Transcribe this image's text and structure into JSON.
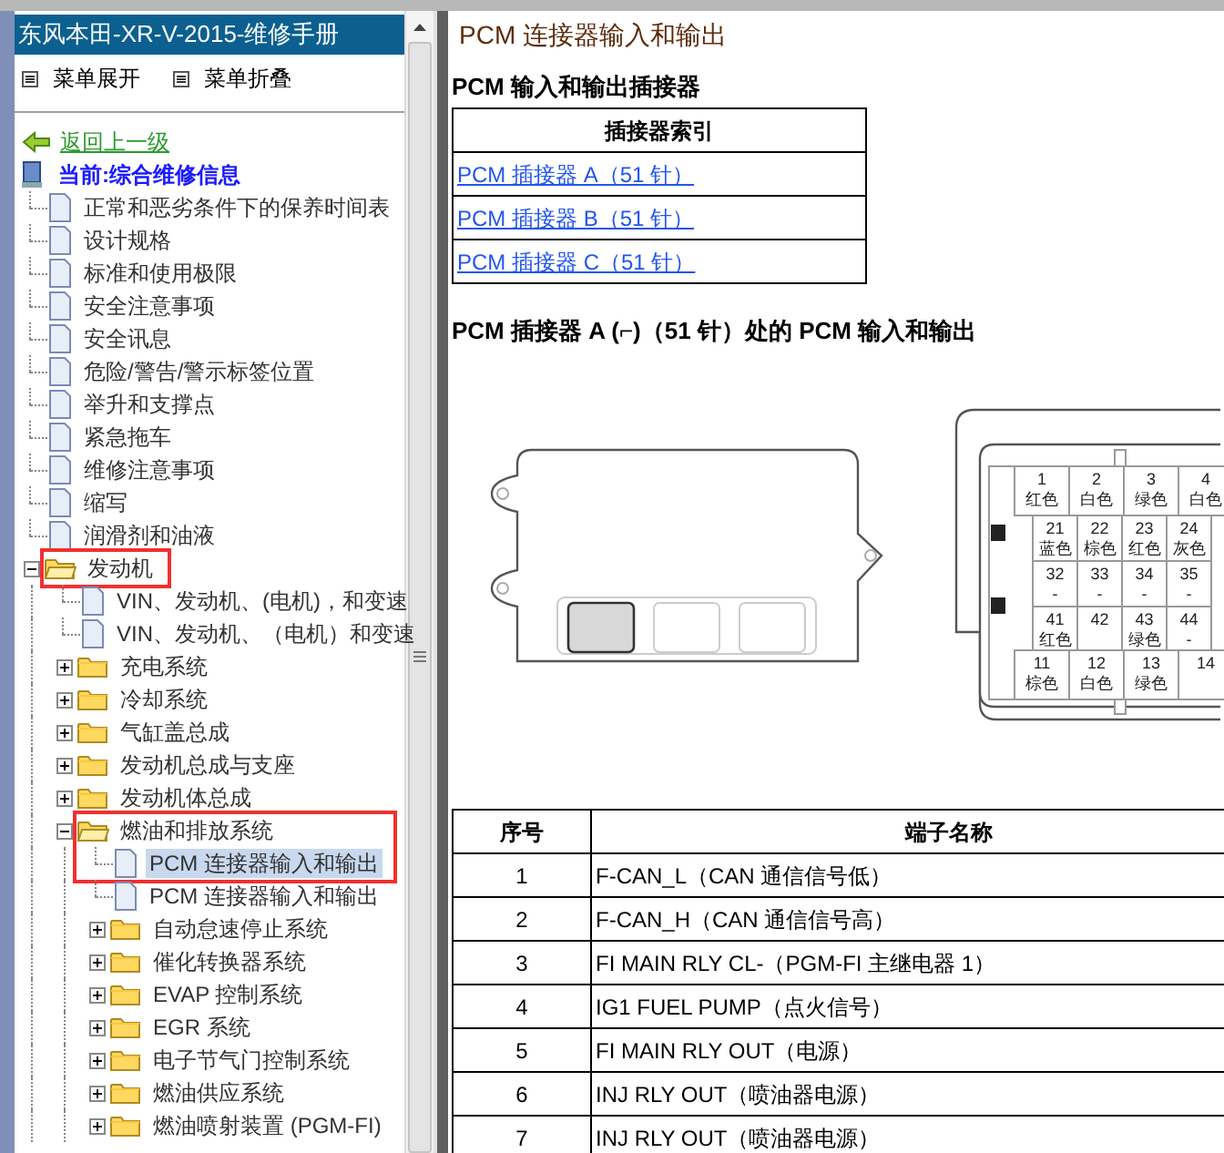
{
  "sidebar": {
    "title": "东风本田-XR-V-2015-维修手册",
    "menu_buttons": [
      "菜单展开",
      "菜单折叠"
    ],
    "back_link": "返回上一级",
    "current": "当前:综合维修信息",
    "tree": [
      {
        "label": "正常和恶劣条件下的保养时间表",
        "kind": "page",
        "selected": false
      },
      {
        "label": "设计规格",
        "kind": "page",
        "selected": false
      },
      {
        "label": "标准和使用极限",
        "kind": "page",
        "selected": false
      },
      {
        "label": "安全注意事项",
        "kind": "page",
        "selected": false
      },
      {
        "label": "安全讯息",
        "kind": "page",
        "selected": false
      },
      {
        "label": "危险/警告/警示标签位置",
        "kind": "page",
        "selected": false
      },
      {
        "label": "举升和支撑点",
        "kind": "page",
        "selected": false
      },
      {
        "label": "紧急拖车",
        "kind": "page",
        "selected": false
      },
      {
        "label": "维修注意事项",
        "kind": "page",
        "selected": false
      },
      {
        "label": "缩写",
        "kind": "page",
        "selected": false
      },
      {
        "label": "润滑剂和油液",
        "kind": "page",
        "selected": false
      },
      {
        "label": "发动机",
        "kind": "folder",
        "expanded": true,
        "selected": false,
        "highlighted": true,
        "children": [
          {
            "label": "VIN、发动机、(电机)，和变速",
            "kind": "page",
            "selected": false
          },
          {
            "label": "VIN、发动机、（电机）和变速",
            "kind": "page",
            "selected": false
          },
          {
            "label": "充电系统",
            "kind": "folder",
            "expanded": false,
            "selected": false
          },
          {
            "label": "冷却系统",
            "kind": "folder",
            "expanded": false,
            "selected": false
          },
          {
            "label": "气缸盖总成",
            "kind": "folder",
            "expanded": false,
            "selected": false
          },
          {
            "label": "发动机总成与支座",
            "kind": "folder",
            "expanded": false,
            "selected": false
          },
          {
            "label": "发动机体总成",
            "kind": "folder",
            "expanded": false,
            "selected": false
          },
          {
            "label": "燃油和排放系统",
            "kind": "folder",
            "expanded": true,
            "selected": false,
            "highlighted": true,
            "children": [
              {
                "label": "PCM 连接器输入和输出",
                "kind": "page",
                "selected": true,
                "highlighted": true
              },
              {
                "label": "PCM 连接器输入和输出",
                "kind": "page",
                "selected": false
              },
              {
                "label": "自动怠速停止系统",
                "kind": "folder",
                "expanded": false,
                "selected": false
              },
              {
                "label": "催化转换器系统",
                "kind": "folder",
                "expanded": false,
                "selected": false
              },
              {
                "label": "EVAP 控制系统",
                "kind": "folder",
                "expanded": false,
                "selected": false
              },
              {
                "label": "EGR 系统",
                "kind": "folder",
                "expanded": false,
                "selected": false
              },
              {
                "label": "电子节气门控制系统",
                "kind": "folder",
                "expanded": false,
                "selected": false
              },
              {
                "label": "燃油供应系统",
                "kind": "folder",
                "expanded": false,
                "selected": false
              },
              {
                "label": "燃油喷射装置 (PGM-FI)",
                "kind": "folder",
                "expanded": false,
                "selected": false
              }
            ]
          }
        ]
      }
    ]
  },
  "content": {
    "title": "PCM 连接器输入和输出",
    "index_heading": "PCM 输入和输出插接器",
    "index_table": {
      "header": "插接器索引",
      "links": [
        "PCM 插接器 A（51 针）",
        "PCM 插接器 B（51 针）",
        "PCM 插接器 C（51 针）"
      ]
    },
    "connector_heading": "PCM 插接器 A (⌐)（51 针）处的 PCM 输入和输出",
    "connector": {
      "rows": [
        {
          "kind": "wide",
          "pins": [
            {
              "number": "1",
              "wire_color": "红色"
            },
            {
              "number": "2",
              "wire_color": "白色"
            },
            {
              "number": "3",
              "wire_color": "绿色"
            },
            {
              "number": "4",
              "wire_color": "白色"
            }
          ]
        },
        {
          "kind": "narrow",
          "pins": [
            {
              "number": "21",
              "wire_color": "蓝色"
            },
            {
              "number": "22",
              "wire_color": "棕色"
            },
            {
              "number": "23",
              "wire_color": "红色"
            },
            {
              "number": "24",
              "wire_color": "灰色"
            }
          ]
        },
        {
          "kind": "narrow",
          "pins": [
            {
              "number": "32",
              "wire_color": "-"
            },
            {
              "number": "33",
              "wire_color": "-"
            },
            {
              "number": "34",
              "wire_color": "-"
            },
            {
              "number": "35",
              "wire_color": "-"
            }
          ]
        },
        {
          "kind": "narrow",
          "pins": [
            {
              "number": "41",
              "wire_color": "红色"
            },
            {
              "number": "42"
            },
            {
              "number": "43",
              "wire_color": "绿色"
            },
            {
              "number": "44",
              "wire_color": "-"
            }
          ]
        },
        {
          "kind": "wide",
          "pins": [
            {
              "number": "11",
              "wire_color": "棕色"
            },
            {
              "number": "12",
              "wire_color": "白色"
            },
            {
              "number": "13",
              "wire_color": "绿色"
            },
            {
              "number": "14"
            }
          ]
        }
      ]
    },
    "terminal_table": {
      "columns": [
        "序号",
        "端子名称"
      ],
      "rows": [
        {
          "number": "1",
          "name": "F-CAN_L（CAN 通信信号低）"
        },
        {
          "number": "2",
          "name": "F-CAN_H（CAN 通信信号高）"
        },
        {
          "number": "3",
          "name": "FI MAIN RLY CL-（PGM-FI 主继电器 1）"
        },
        {
          "number": "4",
          "name": "IG1 FUEL PUMP（点火信号）"
        },
        {
          "number": "5",
          "name": "FI MAIN RLY OUT（电源）"
        },
        {
          "number": "6",
          "name": "INJ RLY OUT（喷油器电源）"
        },
        {
          "number": "7",
          "name": "INJ RLY OUT（喷油器电源）"
        }
      ]
    }
  }
}
